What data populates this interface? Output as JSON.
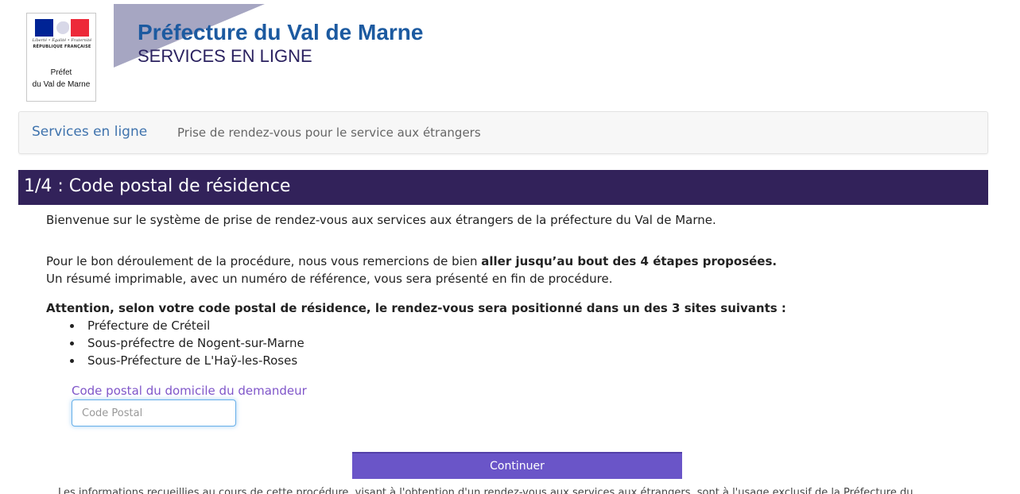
{
  "header": {
    "logo": {
      "motto": "Liberté • Égalité • Fraternité",
      "republic": "RÉPUBLIQUE FRANÇAISE",
      "prefet_line1": "Préfet",
      "prefet_line2": "du Val de Marne",
      "flag_colors": [
        "#002395",
        "#ffffff",
        "#ed2939"
      ]
    },
    "title": "Préfecture du Val de Marne",
    "subtitle": "SERVICES EN LIGNE",
    "title_color": "#1c5aa0"
  },
  "breadcrumb": {
    "home": "Services en ligne",
    "current": "Prise de rendez-vous pour le service aux étrangers"
  },
  "step": {
    "title": "1/4 : Code postal de résidence",
    "bar_color": "#32225a"
  },
  "content": {
    "welcome": "Bienvenue sur le système de prise de rendez-vous aux services aux étrangers de la préfecture du Val de Marne.",
    "procedure_prefix": "Pour le bon déroulement de la procédure, nous vous remercions de bien ",
    "procedure_bold": "aller jusqu’au bout des 4 étapes proposées.",
    "procedure_line2": "Un résumé imprimable, avec un numéro de référence, vous sera présenté en fin de procédure.",
    "warning": "Attention, selon votre code postal de résidence, le rendez-vous sera positionné dans un des 3 sites suivants :",
    "sites": [
      "Préfecture de Créteil",
      "Sous-préfectre de Nogent-sur-Marne",
      "Sous-Préfecture de L'Haÿ-les-Roses"
    ]
  },
  "form": {
    "postal_label": "Code postal du domicile du demandeur",
    "postal_placeholder": "Code Postal",
    "postal_value": "",
    "continue_label": "Continuer",
    "button_color": "#6a55c8"
  },
  "footer": {
    "notice": "Les informations recueillies au cours de cette procédure, visant à l'obtention d'un rendez-vous aux services aux étrangers, sont à l'usage exclusif de la Préfecture du"
  }
}
